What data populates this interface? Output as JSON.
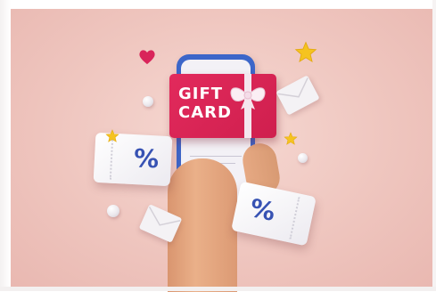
{
  "image": {
    "description_alt": "",
    "background_color": "#efc6bf"
  },
  "gift_card": {
    "line1": "GIFT",
    "line2": "CARD",
    "color": "#d9245a"
  },
  "coupons": {
    "left_symbol": "%",
    "right_symbol": "%",
    "symbol_color": "#3752b3"
  },
  "decor": {
    "heart_color": "#d9245a",
    "star_color": "#f5c320",
    "phone_color": "#3c66c9"
  }
}
